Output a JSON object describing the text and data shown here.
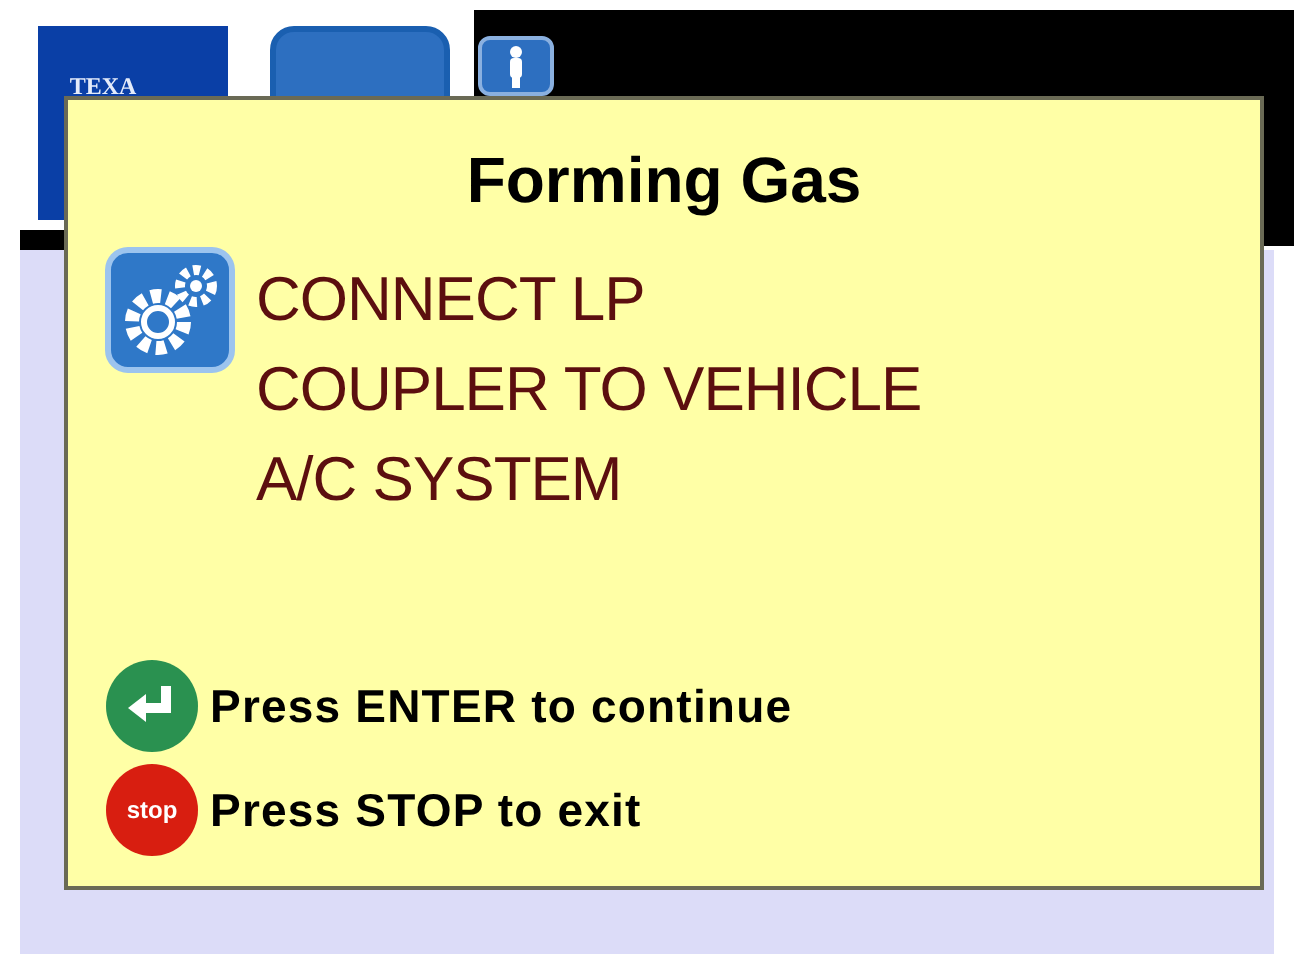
{
  "header": {
    "logo_text": "TEXA"
  },
  "dialog": {
    "title": "Forming Gas",
    "message_lines": [
      "CONNECT LP",
      "COUPLER TO VEHICLE",
      "A/C SYSTEM"
    ],
    "actions": [
      {
        "kind": "enter",
        "text": "Press ENTER to continue"
      },
      {
        "kind": "stop",
        "icon_text": "stop",
        "text": "Press STOP to exit"
      }
    ]
  }
}
